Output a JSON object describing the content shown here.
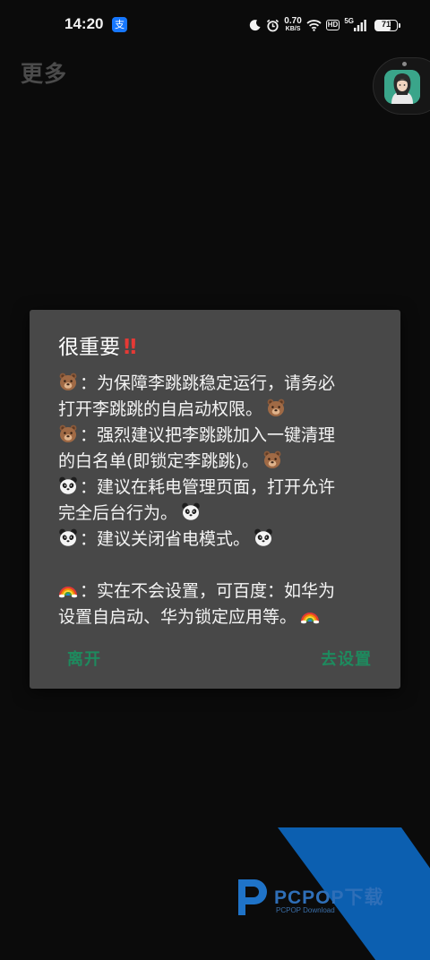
{
  "status_bar": {
    "time": "14:20",
    "app_badge": "支",
    "net_speed_value": "0.70",
    "net_speed_unit": "KB/S",
    "hd_label": "HD",
    "network_label": "5G",
    "battery_percent": 71,
    "battery_text": "71"
  },
  "header": {
    "title": "更多"
  },
  "dialog": {
    "title": "很重要",
    "title_mark": "‼",
    "lines": [
      {
        "lead": "bear",
        "text": "：为保障李跳跳稳定运行，请务必",
        "tail": ""
      },
      {
        "lead": "",
        "text": "打开李跳跳的自启动权限。",
        "tail": "bear"
      },
      {
        "lead": "bear",
        "text": "：强烈建议把李跳跳加入一键清理",
        "tail": ""
      },
      {
        "lead": "",
        "text": "的白名单(即锁定李跳跳)。",
        "tail": "bear"
      },
      {
        "lead": "panda",
        "text": "：建议在耗电管理页面，打开允许",
        "tail": ""
      },
      {
        "lead": "",
        "text": "完全后台行为。",
        "tail": "panda"
      },
      {
        "lead": "panda",
        "text": "：建议关闭省电模式。",
        "tail": "panda"
      },
      {
        "lead": "rainbow",
        "text": "：实在不会设置，可百度：如华为",
        "tail": ""
      },
      {
        "lead": "",
        "text": "设置自启动、华为锁定应用等。",
        "tail": "rainbow"
      }
    ],
    "leave_label": "离开",
    "settings_label": "去设置",
    "accent_color": "#1e8a5e"
  },
  "watermark": {
    "name": "PCPOP下载",
    "sub": "PCPOP Download"
  }
}
